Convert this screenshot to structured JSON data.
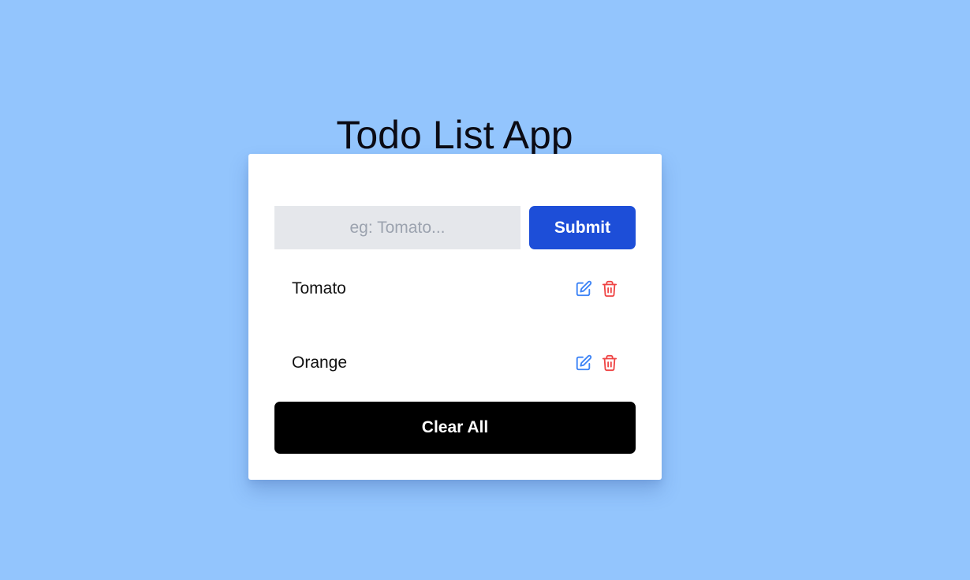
{
  "app": {
    "title": "Todo List App",
    "background_color": "#93c5fd"
  },
  "form": {
    "input_value": "",
    "input_placeholder": "eg: Tomato...",
    "submit_label": "Submit",
    "submit_color": "#1d4ed8"
  },
  "todos": [
    {
      "text": "Tomato",
      "edit_icon": "pencil-square-icon",
      "delete_icon": "trash-icon"
    },
    {
      "text": "Orange",
      "edit_icon": "pencil-square-icon",
      "delete_icon": "trash-icon"
    }
  ],
  "icon_colors": {
    "edit": "#3b82f6",
    "delete": "#ef4444"
  },
  "clear_all_label": "Clear All",
  "clear_all_color": "#000000"
}
